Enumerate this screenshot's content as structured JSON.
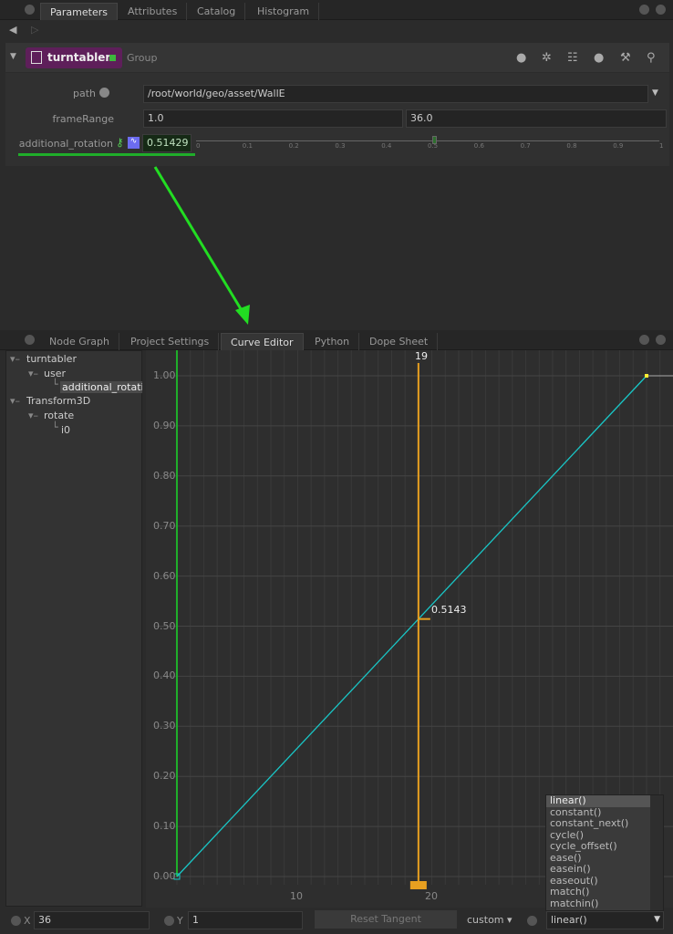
{
  "top_panel": {
    "tabs": [
      "Parameters",
      "Attributes",
      "Catalog",
      "Histogram"
    ],
    "active_tab": "Parameters"
  },
  "node": {
    "name": "turntabler",
    "type": "Group",
    "color": "#5e1f5a"
  },
  "params": {
    "path": {
      "label": "path",
      "value": "/root/world/geo/asset/WallE"
    },
    "frameRange": {
      "label": "frameRange",
      "start": "1.0",
      "end": "36.0"
    },
    "additional_rotation": {
      "label": "additional_rotation",
      "value": "0.51429",
      "slider_value": 0.51429,
      "ticks": [
        "0",
        "0.1",
        "0.2",
        "0.3",
        "0.4",
        "0.5",
        "0.6",
        "0.7",
        "0.8",
        "0.9",
        "1"
      ]
    }
  },
  "bottom_panel": {
    "tabs": [
      "Node Graph",
      "Project Settings",
      "Curve Editor",
      "Python",
      "Dope Sheet"
    ],
    "active_tab": "Curve Editor"
  },
  "tree": [
    "turntabler",
    "user",
    "additional_rotation",
    "Transform3D",
    "rotate",
    "i0"
  ],
  "chart_data": {
    "type": "line",
    "x": [
      1,
      36
    ],
    "y": [
      0,
      1
    ],
    "xlim": [
      1,
      40
    ],
    "ylim": [
      0,
      1
    ],
    "x_ticks": [
      "10",
      "20"
    ],
    "y_ticks": [
      "0.00",
      "0.10",
      "0.20",
      "0.30",
      "0.40",
      "0.50",
      "0.60",
      "0.70",
      "0.80",
      "0.90",
      "1.00"
    ],
    "current_frame": 19,
    "current_frame_label": "19",
    "current_value_label": "0.5143",
    "curve_color": "#19c6c6",
    "playhead_color": "#e8a020",
    "frame_start_color": "#1fae2a"
  },
  "footer": {
    "x_label": "X",
    "x_value": "36",
    "y_label": "Y",
    "y_value": "1",
    "reset_tangent": "Reset Tangent",
    "custom": "custom",
    "expression": "linear()"
  },
  "dropdown": [
    "linear()",
    "constant()",
    "constant_next()",
    "cycle()",
    "cycle_offset()",
    "ease()",
    "easein()",
    "easeout()",
    "match()",
    "matchin()"
  ]
}
